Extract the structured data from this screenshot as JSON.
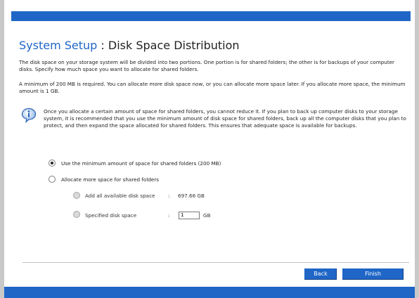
{
  "header": {
    "title_main": "System Setup",
    "title_sep": " : ",
    "title_sub": "Disk Space Distribution"
  },
  "intro": {
    "p1": "The disk space on your storage system will be divided into two portions. One portion is for shared folders; the other is for backups of your computer disks. Specify how much space you want to allocate for shared folders.",
    "p2": "A minimum of 200 MB is required. You can allocate more disk space now, or you can allocate more space later. If you allocate more space, the minimum amount is 1 GB."
  },
  "note": {
    "icon": "info-icon",
    "text": "Once you allocate a certain amount of space for shared folders, you cannot reduce it. If you plan to back up computer disks to your storage system, it is recommended that you use the minimum amount of disk space for shared folders, back up all the computer disks that you plan to protect, and then expand the space allocated for shared folders. This ensures that adequate space is available for backups."
  },
  "options": {
    "minimum": {
      "label": "Use the minimum amount of space for shared folders (200 MB)",
      "selected": true
    },
    "more": {
      "label": "Allocate more space for shared folders",
      "selected": false
    },
    "add_all": {
      "label": "Add all available disk space",
      "sep": ":",
      "value": "697.66 GB"
    },
    "specified": {
      "label": "Specified disk space",
      "sep": ":",
      "value": "1",
      "unit": "GB"
    }
  },
  "buttons": {
    "back": "Back",
    "finish": "Finish"
  },
  "colors": {
    "accent": "#1f66c7",
    "border": "#c9c9c9"
  }
}
